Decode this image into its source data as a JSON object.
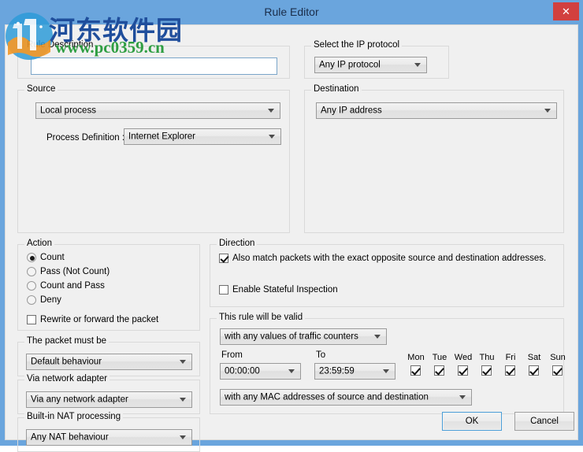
{
  "window": {
    "title": "Rule Editor",
    "close_label": "✕",
    "titlebar_color": "#6aa5dd",
    "close_color": "#d2403f"
  },
  "watermark": {
    "cn_text": "河东软件园",
    "url_text": "www.pc0359.cn",
    "cn_color": "#1f4e9c",
    "url_color": "#2f9e42"
  },
  "rule_description": {
    "group_title": "Rule Description",
    "value": "",
    "placeholder": ""
  },
  "ip_protocol": {
    "group_title": "Select the IP protocol",
    "selected": "Any IP protocol"
  },
  "source": {
    "group_title": "Source",
    "selected": "Local process",
    "process_label": "Process Definition :",
    "process_selected": "Internet Explorer"
  },
  "destination": {
    "group_title": "Destination",
    "selected": "Any IP address"
  },
  "action": {
    "group_title": "Action",
    "options": [
      {
        "label": "Count",
        "checked": true
      },
      {
        "label": "Pass (Not Count)",
        "checked": false
      },
      {
        "label": "Count and Pass",
        "checked": false
      },
      {
        "label": "Deny",
        "checked": false
      }
    ],
    "rewrite": {
      "label": "Rewrite or forward the packet",
      "checked": false
    }
  },
  "direction": {
    "group_title": "Direction",
    "opposite": {
      "label": "Also match packets with the exact opposite source and destination addresses.",
      "checked": true
    },
    "stateful": {
      "label": "Enable Stateful Inspection",
      "checked": false
    }
  },
  "validity": {
    "group_title": "This rule will be valid",
    "counters_selected": "with any values of traffic counters",
    "from_label": "From",
    "to_label": "To",
    "from_value": "00:00:00",
    "to_value": "23:59:59",
    "mac_selected": "with any MAC addresses of source and destination",
    "days": [
      {
        "name": "Mon",
        "checked": true
      },
      {
        "name": "Tue",
        "checked": true
      },
      {
        "name": "Wed",
        "checked": true
      },
      {
        "name": "Thu",
        "checked": true
      },
      {
        "name": "Fri",
        "checked": true
      },
      {
        "name": "Sat",
        "checked": true
      },
      {
        "name": "Sun",
        "checked": true
      }
    ]
  },
  "packet_must_be": {
    "group_title": "The packet must be",
    "selected": "Default behaviour"
  },
  "network_adapter": {
    "group_title": "Via network adapter",
    "selected": "Via any network adapter"
  },
  "nat": {
    "group_title": "Built-in NAT processing",
    "selected": "Any NAT behaviour"
  },
  "footer": {
    "ok_label": "OK",
    "cancel_label": "Cancel"
  }
}
